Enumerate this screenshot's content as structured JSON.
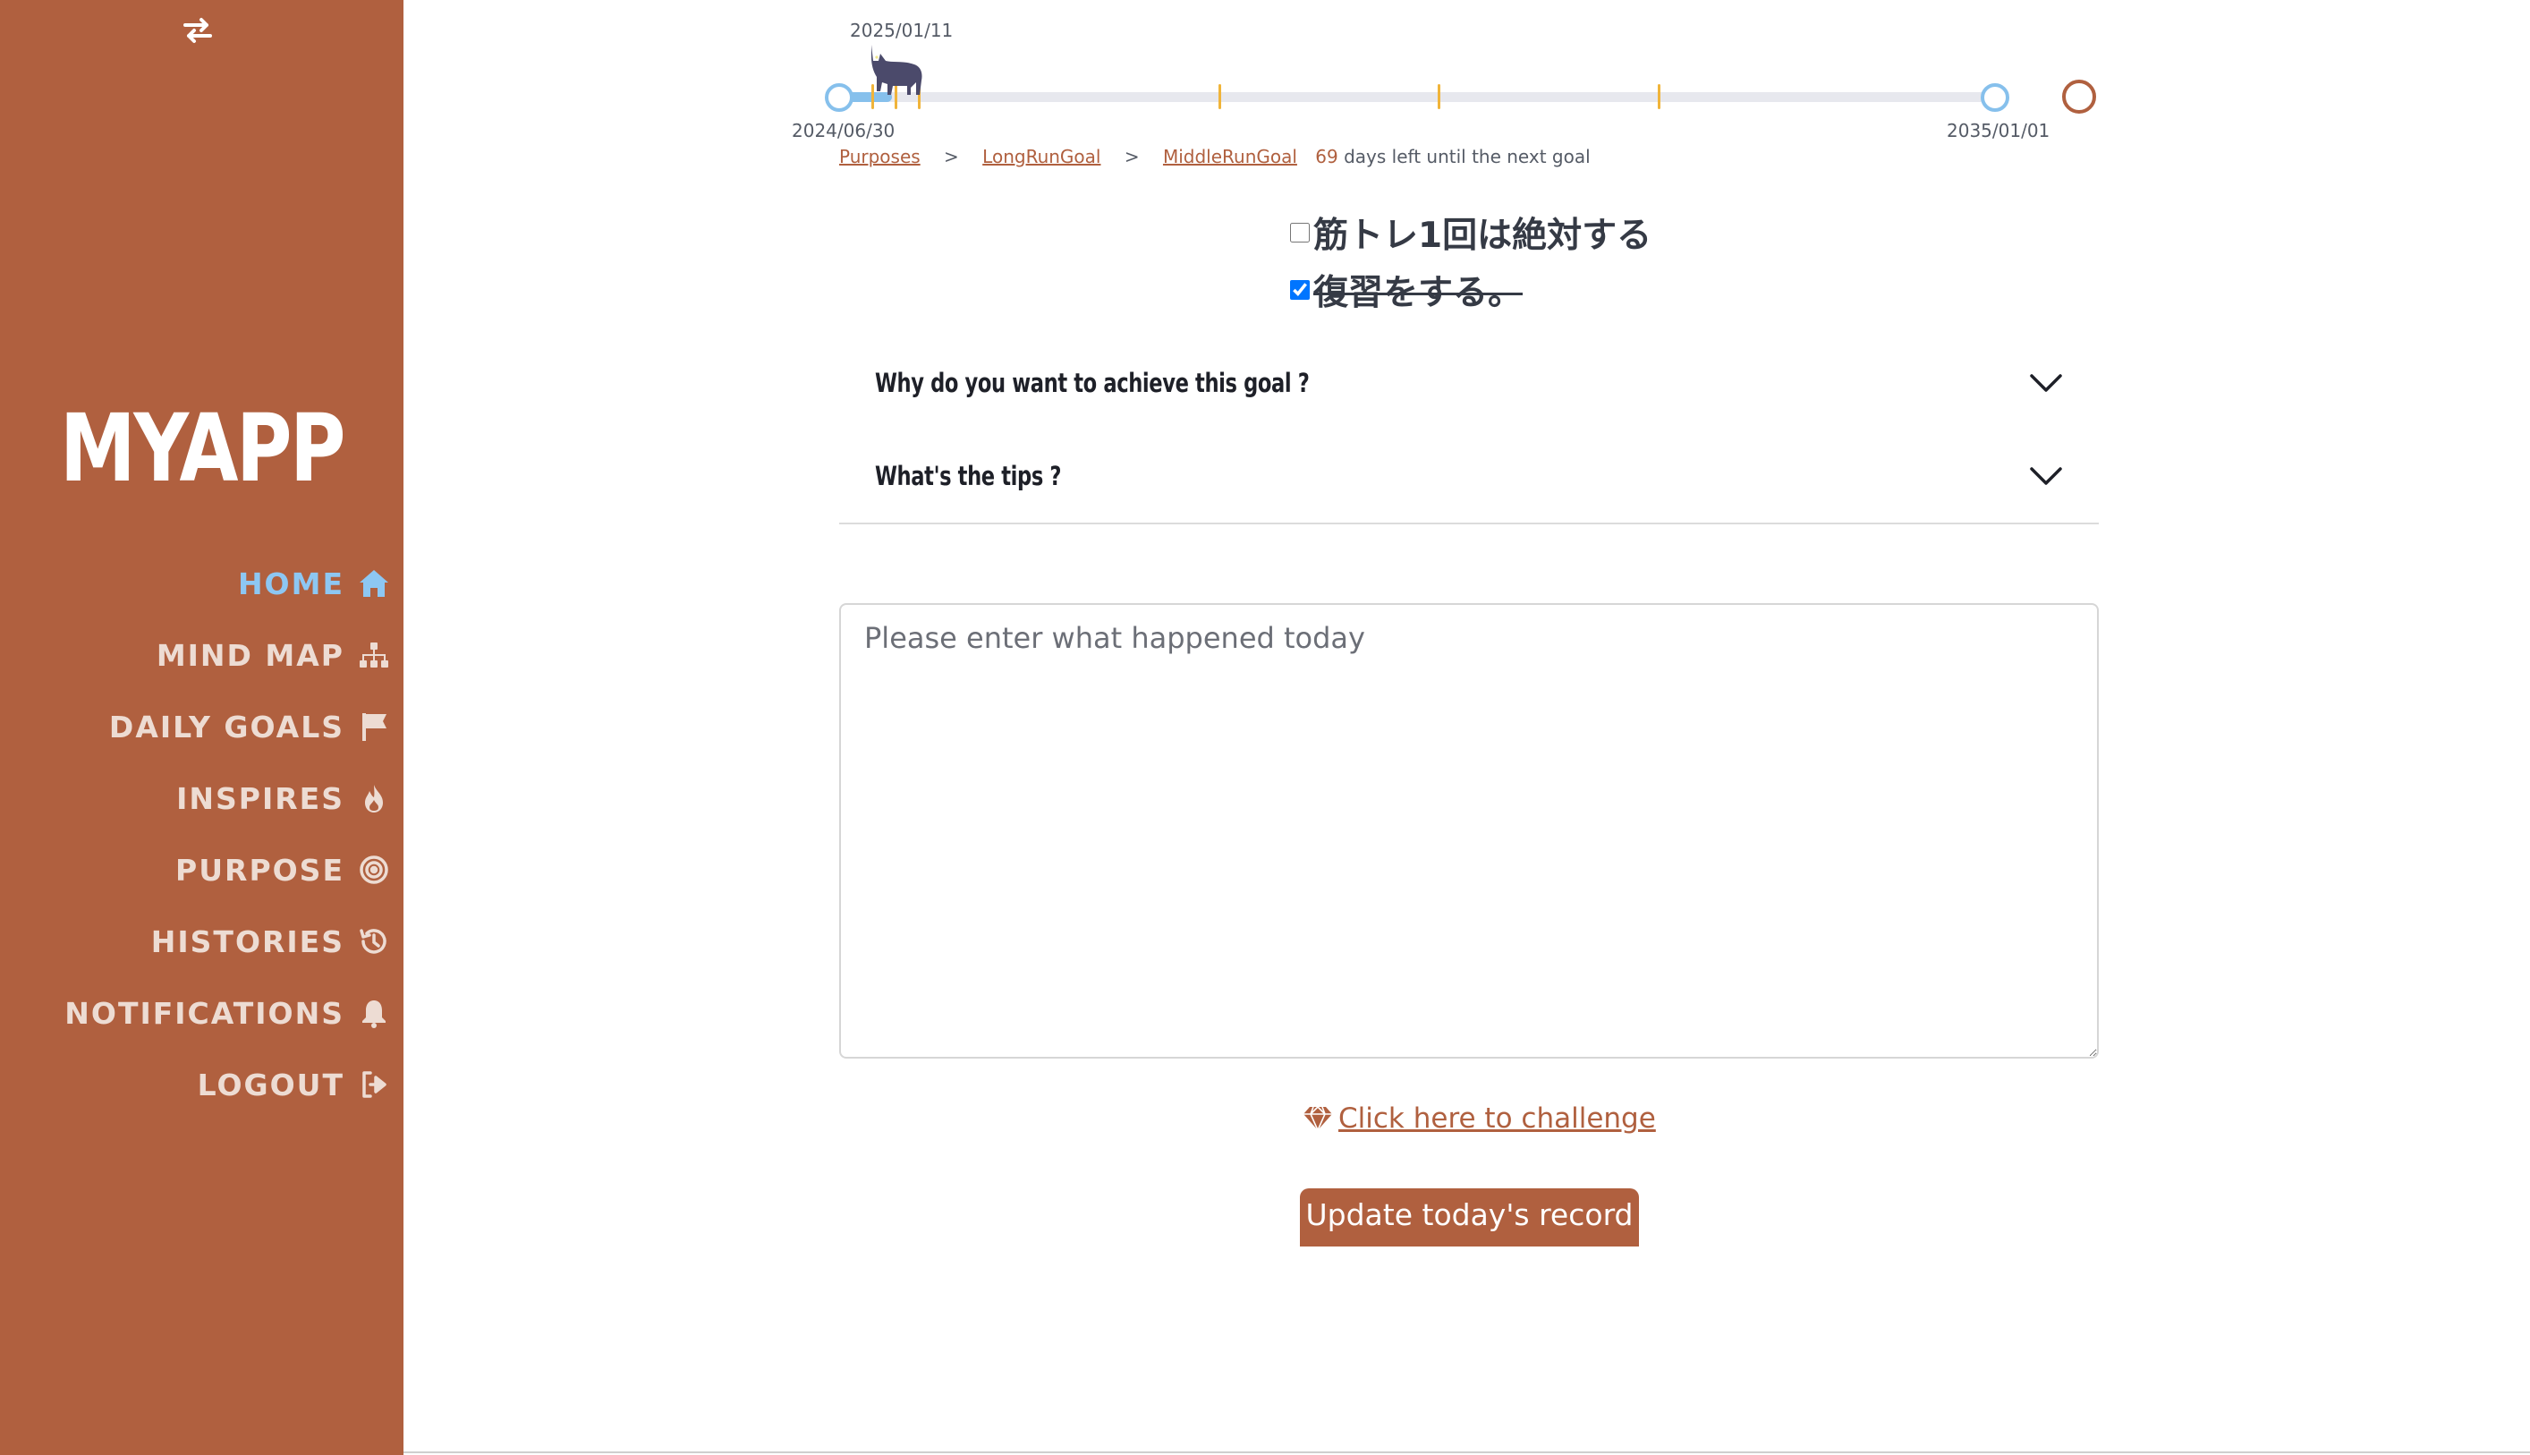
{
  "theme": {
    "accent": "#b0603f",
    "sidebar_bg": "#b0603f",
    "active_nav": "#8dc7f3",
    "timeline_track": "#e7e8ee",
    "timeline_node": "#86c0ec",
    "timeline_tick": "#f0b43a"
  },
  "sidebar": {
    "toggle_icon": "swap-arrows-icon",
    "brand": "MYAPP",
    "items": [
      {
        "label": "HOME",
        "icon": "home-icon",
        "active": true
      },
      {
        "label": "MIND MAP",
        "icon": "sitemap-icon",
        "active": false
      },
      {
        "label": "DAILY GOALS",
        "icon": "flag-icon",
        "active": false
      },
      {
        "label": "INSPIRES",
        "icon": "fire-icon",
        "active": false
      },
      {
        "label": "PURPOSE",
        "icon": "target-icon",
        "active": false
      },
      {
        "label": "HISTORIES",
        "icon": "history-icon",
        "active": false
      },
      {
        "label": "NOTIFICATIONS",
        "icon": "bell-icon",
        "active": false
      },
      {
        "label": "LOGOUT",
        "icon": "logout-icon",
        "active": false
      }
    ]
  },
  "timeline": {
    "current_date": "2025/01/11",
    "start_date": "2024/06/30",
    "end_date": "2035/01/01",
    "mascot": "cat-icon"
  },
  "breadcrumb": {
    "items": [
      "Purposes",
      "LongRunGoal",
      "MiddleRunGoal"
    ],
    "separator": ">",
    "days_left": "69",
    "days_left_text": "days left until the next goal"
  },
  "tasks": [
    {
      "label": "筋トレ1回は絶対する",
      "checked": false
    },
    {
      "label": "復習をする。",
      "checked": true
    }
  ],
  "accordion": [
    {
      "title": "Why do you want to achieve this goal ?",
      "icon": "chevron-down-icon"
    },
    {
      "title": "What's the tips ?",
      "icon": "chevron-down-icon"
    }
  ],
  "journal": {
    "placeholder": "Please enter what happened today",
    "value": ""
  },
  "challenge_link": {
    "label": " Click here to challenge",
    "icon": "gem-icon"
  },
  "submit_button": {
    "label": "Update today's record"
  }
}
